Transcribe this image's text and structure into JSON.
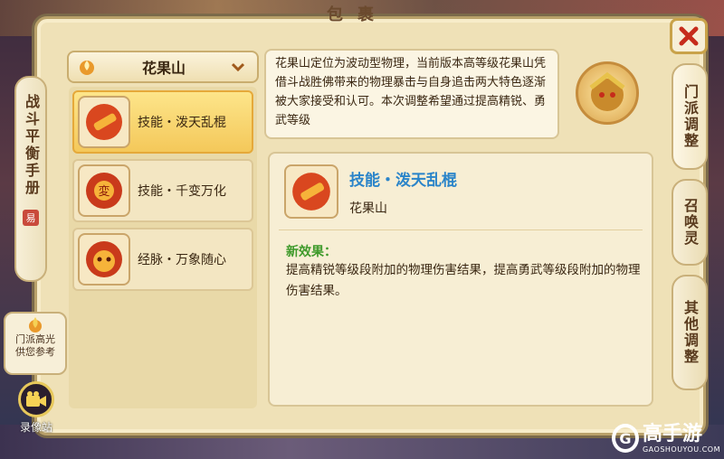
{
  "window": {
    "title": "包裹"
  },
  "left_tab": {
    "label": "战斗平衡手册",
    "seal": "易"
  },
  "highlight": {
    "line1": "门派高光",
    "line2": "供您参考"
  },
  "record": {
    "label": "录像站"
  },
  "dropdown": {
    "selected": "花果山"
  },
  "skills": [
    {
      "name": "技能・泼天乱棍",
      "selected": true
    },
    {
      "name": "技能・千变万化",
      "selected": false
    },
    {
      "name": "经脉・万象随心",
      "selected": false
    }
  ],
  "description": {
    "text": "花果山定位为波动型物理，当前版本高等级花果山凭借斗战胜佛带来的物理暴击与自身追击两大特色逐渐被大家接受和认可。本次调整希望通过提高精锐、勇武等级"
  },
  "detail": {
    "title": "技能・泼天乱棍",
    "subtitle": "花果山",
    "effect_label": "新效果：",
    "effect_text": "提高精锐等级段附加的物理伤害结果，提高勇武等级段附加的物理伤害结果。"
  },
  "right_tabs": [
    {
      "label": "门派调整"
    },
    {
      "label": "召唤灵"
    },
    {
      "label": "其他调整"
    }
  ],
  "watermark": {
    "main": "高手游",
    "sub": "GAOSHOUYOU.COM"
  },
  "colors": {
    "accent_title": "#2a84c9",
    "effect_green": "#3f9a2b",
    "selected_gold": "#f4c85a"
  }
}
